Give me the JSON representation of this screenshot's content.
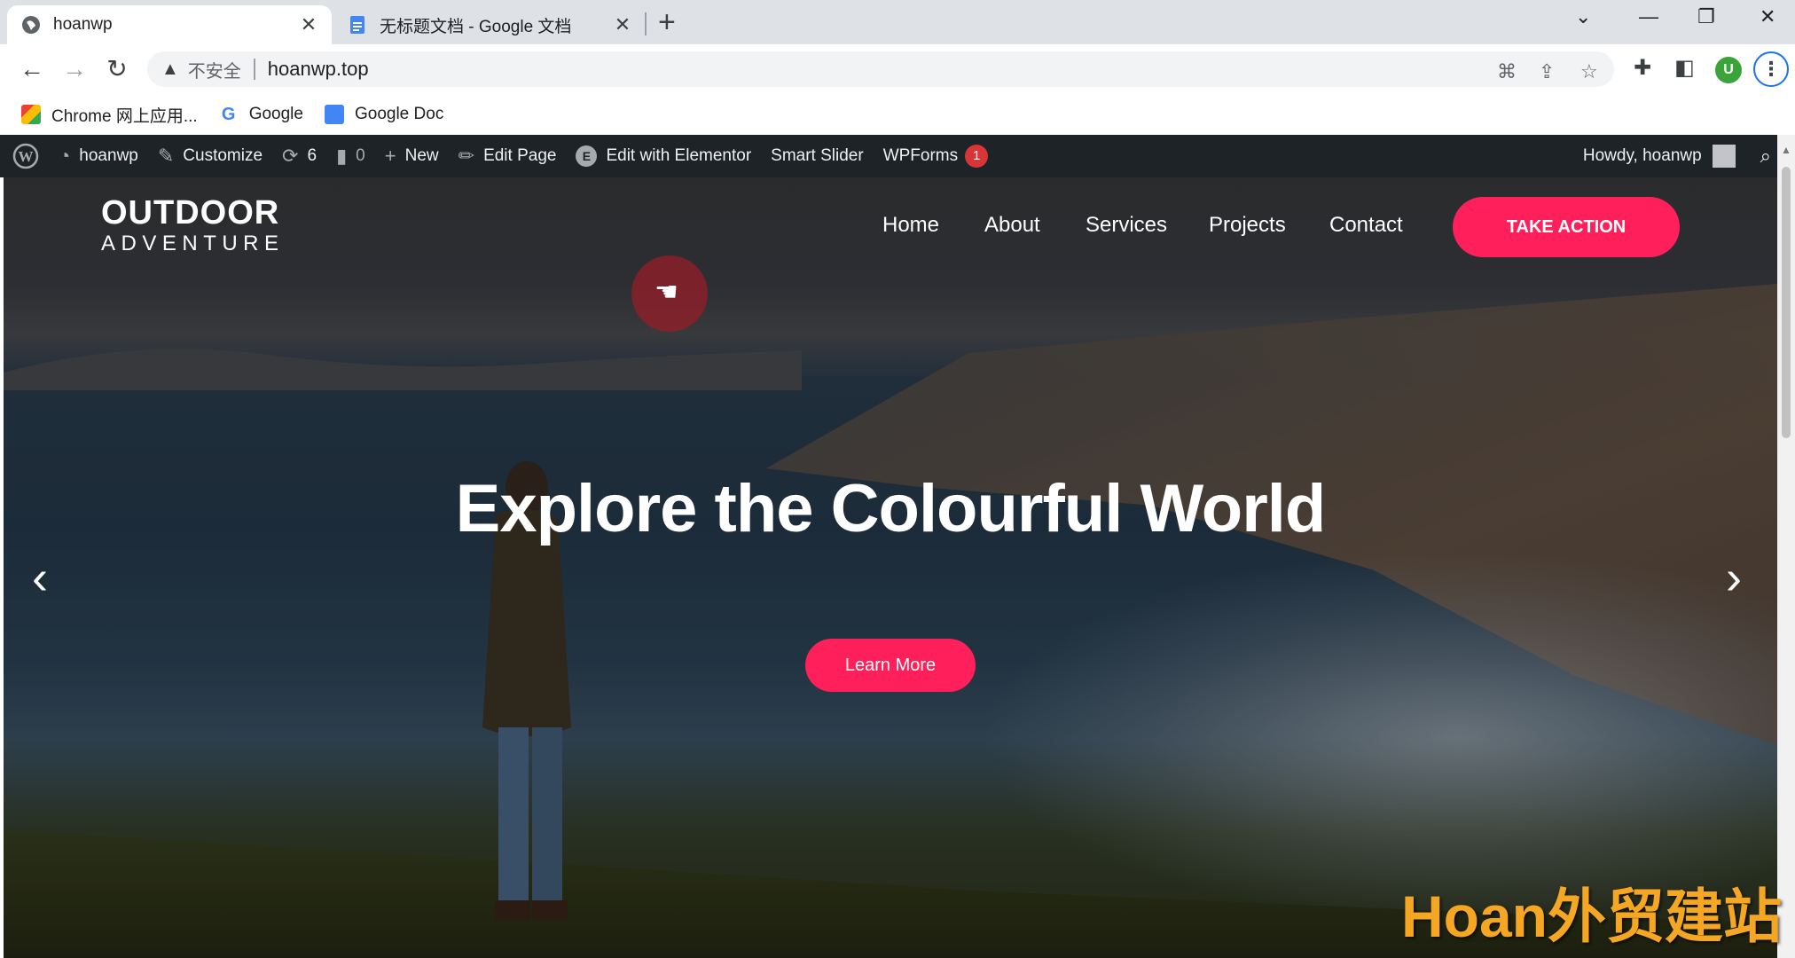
{
  "browser": {
    "tabs": [
      {
        "title": "hoanwp",
        "active": true
      },
      {
        "title": "无标题文档 - Google 文档",
        "active": false
      }
    ],
    "url": "hoanwp.top",
    "insecure_label": "不安全",
    "bookmarks": [
      "Chrome 网上应用...",
      "Google",
      "Google Doc"
    ],
    "profile_initial": "U"
  },
  "wp_admin_bar": {
    "site_name": "hoanwp",
    "customize": "Customize",
    "updates_count": "6",
    "comments_count": "0",
    "new": "New",
    "edit_page": "Edit Page",
    "edit_elementor": "Edit with Elementor",
    "smart_slider": "Smart Slider",
    "wpforms": "WPForms",
    "wpforms_badge": "1",
    "howdy": "Howdy, hoanwp"
  },
  "site": {
    "logo_line1": "OUTDOOR",
    "logo_line2": "ADVENTURE",
    "nav": [
      "Home",
      "About",
      "Services",
      "Projects",
      "Contact"
    ],
    "cta": "TAKE ACTION",
    "headline": "Explore the Colourful World",
    "learn_more": "Learn More"
  },
  "watermark": "Hoan外贸建站",
  "colors": {
    "accent": "#ff1f5a",
    "wp_bar": "#1d2327"
  }
}
